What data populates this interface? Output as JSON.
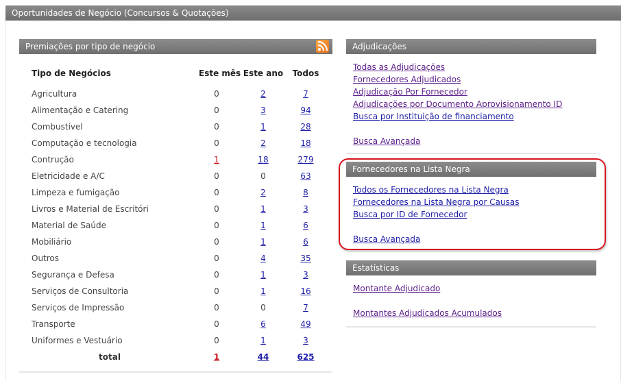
{
  "page": {
    "title": "Oportunidades de Negócio (Concursos & Quotações)"
  },
  "premiacoes": {
    "title": "Premiações por tipo de negócio",
    "rss_icon": "rss-icon",
    "headers": {
      "tipo": "Tipo de Negócios",
      "mes": "Este mês",
      "ano": "Este ano",
      "todos": "Todos"
    },
    "rows": [
      {
        "tipo": "Agricultura",
        "mes": "0",
        "ano": "2",
        "todos": "7"
      },
      {
        "tipo": "Alimentação e Catering",
        "mes": "0",
        "ano": "3",
        "todos": "94"
      },
      {
        "tipo": "Combustível",
        "mes": "0",
        "ano": "1",
        "todos": "28"
      },
      {
        "tipo": "Computação e tecnologia",
        "mes": "0",
        "ano": "2",
        "todos": "18"
      },
      {
        "tipo": "Contrução",
        "mes": "1",
        "ano": "18",
        "todos": "279"
      },
      {
        "tipo": "Eletricidade e A/C",
        "mes": "0",
        "ano": "0",
        "todos": "63"
      },
      {
        "tipo": "Limpeza e fumigação",
        "mes": "0",
        "ano": "2",
        "todos": "8"
      },
      {
        "tipo": "Livros e Material de Escritóri",
        "mes": "0",
        "ano": "1",
        "todos": "3"
      },
      {
        "tipo": "Material de Saúde",
        "mes": "0",
        "ano": "1",
        "todos": "6"
      },
      {
        "tipo": "Mobiliário",
        "mes": "0",
        "ano": "1",
        "todos": "6"
      },
      {
        "tipo": "Outros",
        "mes": "0",
        "ano": "4",
        "todos": "35"
      },
      {
        "tipo": "Segurança e Defesa",
        "mes": "0",
        "ano": "1",
        "todos": "3"
      },
      {
        "tipo": "Serviços de Consultoria",
        "mes": "0",
        "ano": "1",
        "todos": "16"
      },
      {
        "tipo": "Serviços de Impressão",
        "mes": "0",
        "ano": "0",
        "todos": "7"
      },
      {
        "tipo": "Transporte",
        "mes": "0",
        "ano": "6",
        "todos": "49"
      },
      {
        "tipo": "Uniformes e Vestuário",
        "mes": "0",
        "ano": "1",
        "todos": "3"
      }
    ],
    "total": {
      "label": "total",
      "mes": "1",
      "ano": "44",
      "todos": "625"
    }
  },
  "adjudicacoes": {
    "title": "Adjudicações",
    "links": [
      "Todas as Adjudicações",
      "Fornecedores Adjudicados",
      "Adjudicação Por Fornecedor",
      "Adjudicações por Documento Aprovisionamento ID",
      "Busca por Instituição de financiamento"
    ],
    "advanced": "Busca Avançada"
  },
  "lista_negra": {
    "title": "Fornecedores na Lista Negra",
    "links": [
      "Todos os Fornecedores na Lista Negra",
      "Fornecedores na Lista Negra por Causas",
      "Busca por ID de Fornecedor"
    ],
    "advanced": "Busca Avançada"
  },
  "estatisticas": {
    "title": "Estatísticas",
    "links": [
      "Montante Adjudicado",
      "Montantes Adjudicados Acumulados"
    ]
  },
  "colors": {
    "header_bg": "#7a7a7a",
    "link": "#1e1ea8",
    "visited_link": "#5c1f8a",
    "alert_red": "#c8141e",
    "rss_orange": "#ef8a2a"
  }
}
